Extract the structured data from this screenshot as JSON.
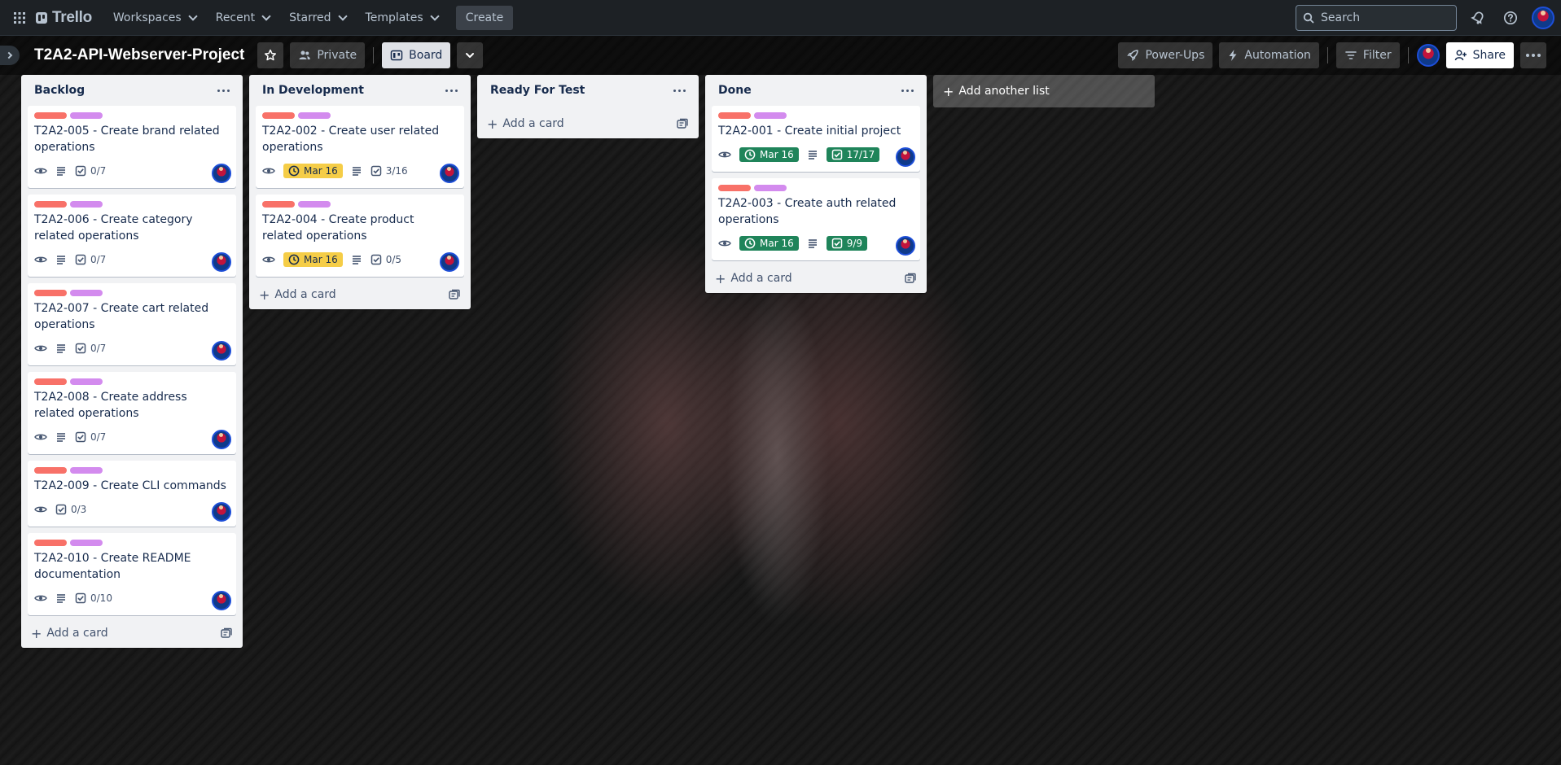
{
  "topnav": {
    "logo": "Trello",
    "menus": [
      "Workspaces",
      "Recent",
      "Starred",
      "Templates"
    ],
    "create_label": "Create",
    "search_placeholder": "Search"
  },
  "board": {
    "title": "T2A2-API-Webserver-Project",
    "visibility": "Private",
    "view": "Board",
    "powerups_label": "Power-Ups",
    "automation_label": "Automation",
    "filter_label": "Filter",
    "share_label": "Share"
  },
  "lists": [
    {
      "title": "Backlog",
      "add_card_label": "Add a card",
      "cards": [
        {
          "title": "T2A2-005 - Create brand related operations",
          "checklist": "0/7",
          "description": true
        },
        {
          "title": "T2A2-006 - Create category related operations",
          "checklist": "0/7",
          "description": true
        },
        {
          "title": "T2A2-007 - Create cart related operations",
          "checklist": "0/7",
          "description": true
        },
        {
          "title": "T2A2-008 - Create address related operations",
          "checklist": "0/7",
          "description": true
        },
        {
          "title": "T2A2-009 - Create CLI commands",
          "checklist": "0/3",
          "description": false
        },
        {
          "title": "T2A2-010 - Create README documentation",
          "checklist": "0/10",
          "description": true
        }
      ]
    },
    {
      "title": "In Development",
      "add_card_label": "Add a card",
      "cards": [
        {
          "title": "T2A2-002 - Create user related operations",
          "due": "Mar 16",
          "due_status": "due-soon",
          "checklist": "3/16",
          "description": true
        },
        {
          "title": "T2A2-004 - Create product related operations",
          "due": "Mar 16",
          "due_status": "due-soon",
          "checklist": "0/5",
          "description": true
        }
      ]
    },
    {
      "title": "Ready For Test",
      "add_card_label": "Add a card",
      "cards": []
    },
    {
      "title": "Done",
      "add_card_label": "Add a card",
      "cards": [
        {
          "title": "T2A2-001 - Create initial project",
          "due": "Mar 16",
          "due_status": "complete",
          "checklist": "17/17",
          "description": true
        },
        {
          "title": "T2A2-003 - Create auth related operations",
          "due": "Mar 16",
          "due_status": "complete",
          "checklist": "9/9",
          "description": true
        }
      ]
    }
  ],
  "add_list_label": "Add another list",
  "colors": {
    "label_red": "#f87168",
    "label_purple": "#d38bee",
    "due_soon": "#f5cd47",
    "complete": "#1f845a"
  }
}
